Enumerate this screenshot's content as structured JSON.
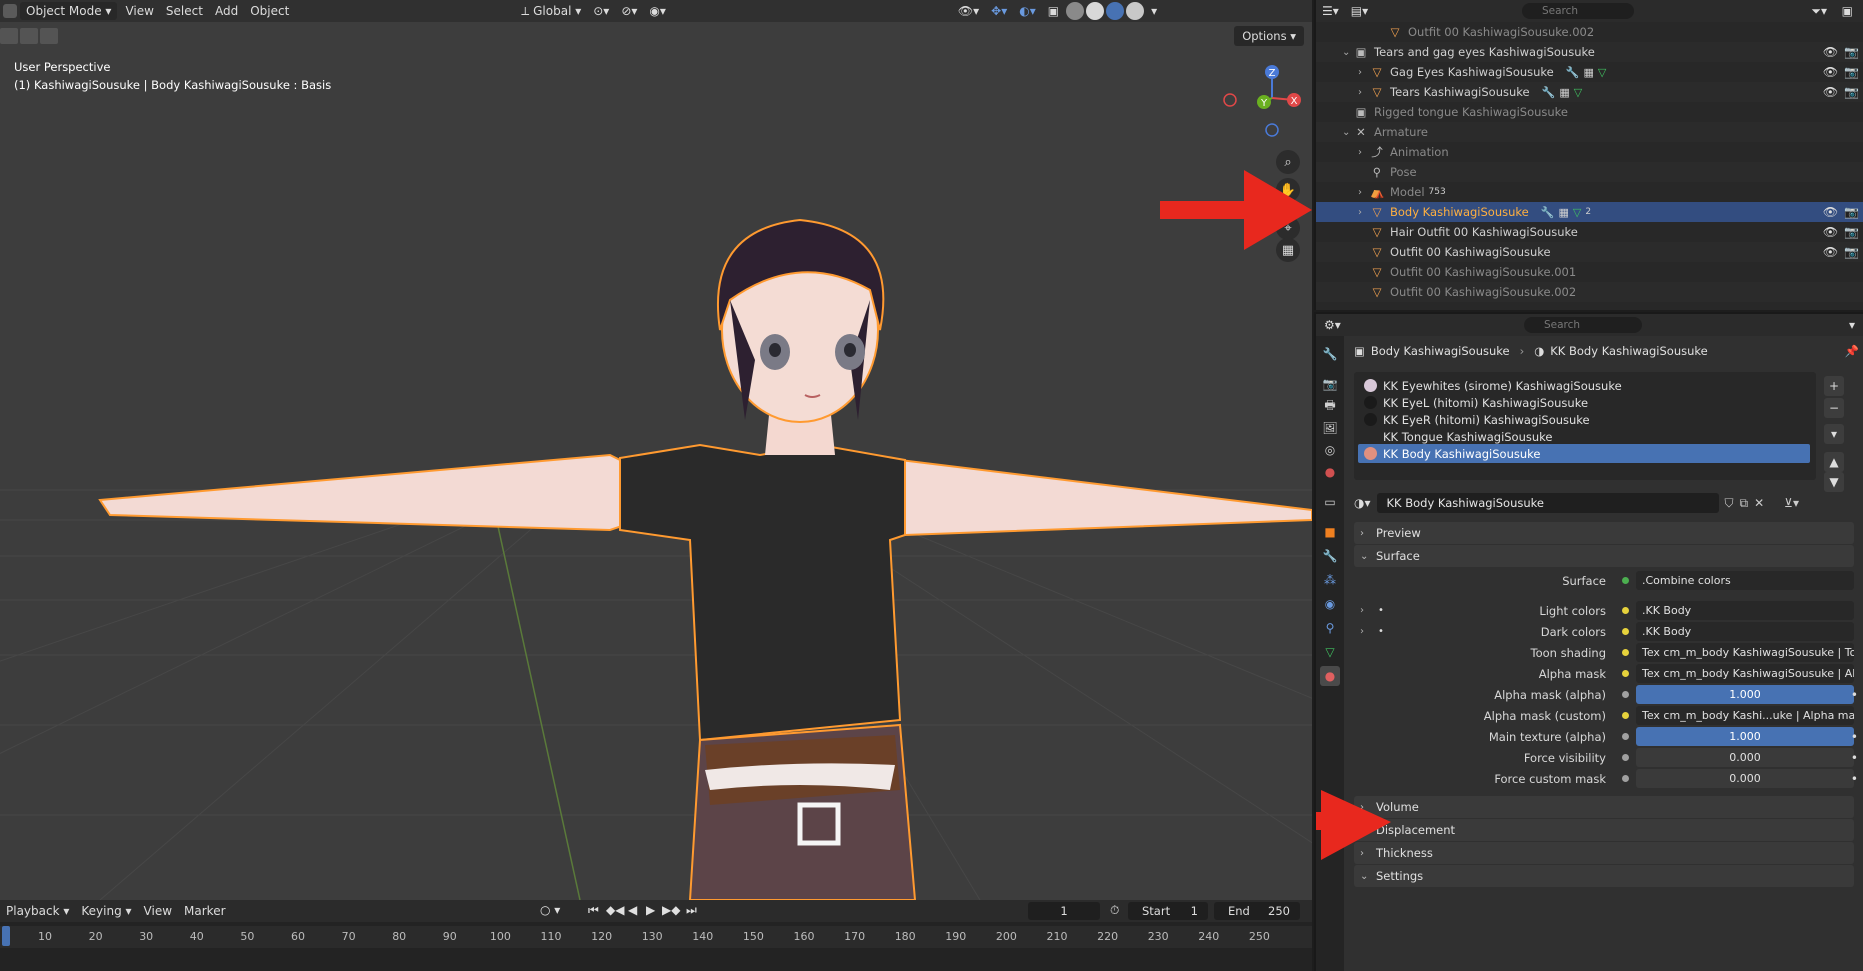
{
  "viewport": {
    "header": {
      "mode": "Object Mode",
      "menus": [
        "View",
        "Select",
        "Add",
        "Object"
      ],
      "orientation": "Global"
    },
    "info_line1": "User Perspective",
    "info_line2": "(1) KashiwagiSousuke | Body KashiwagiSousuke : Basis",
    "options_label": "Options",
    "gizmo": {
      "x": "X",
      "y": "Y",
      "z": "Z"
    }
  },
  "timeline": {
    "menus": [
      "Playback",
      "Keying",
      "View",
      "Marker"
    ],
    "current_frame": "1",
    "start_label": "Start",
    "start_value": "1",
    "end_label": "End",
    "end_value": "250",
    "ticks": [
      "10",
      "20",
      "30",
      "40",
      "50",
      "60",
      "70",
      "80",
      "90",
      "100",
      "110",
      "120",
      "130",
      "140",
      "150",
      "160",
      "170",
      "180",
      "190",
      "200",
      "210",
      "220",
      "230",
      "240",
      "250"
    ]
  },
  "outliner": {
    "search_placeholder": "Search",
    "rows": [
      {
        "label": "Outfit 00 KashiwagiSousuke.002",
        "dim": true
      },
      {
        "label": "Tears and gag eyes KashiwagiSousuke",
        "dim": false
      },
      {
        "label": "Gag Eyes KashiwagiSousuke",
        "dim": false
      },
      {
        "label": "Tears KashiwagiSousuke",
        "dim": false
      },
      {
        "label": "Rigged tongue KashiwagiSousuke",
        "dim": true
      },
      {
        "label": "Armature",
        "dim": true
      },
      {
        "label": "Animation",
        "dim": true
      },
      {
        "label": "Pose",
        "dim": true
      },
      {
        "label": "Model",
        "dim": true,
        "badge": "753"
      },
      {
        "label": "Body KashiwagiSousuke",
        "selected": true,
        "badge": "2"
      },
      {
        "label": "Hair Outfit 00 KashiwagiSousuke",
        "dim": false
      },
      {
        "label": "Outfit 00 KashiwagiSousuke",
        "dim": false
      },
      {
        "label": "Outfit 00 KashiwagiSousuke.001",
        "dim": true
      },
      {
        "label": "Outfit 00 KashiwagiSousuke.002",
        "dim": true
      }
    ]
  },
  "properties": {
    "search_placeholder": "Search",
    "breadcrumb_object": "Body KashiwagiSousuke",
    "breadcrumb_material": "KK Body KashiwagiSousuke",
    "slots": [
      {
        "label": "KK Eyewhites (sirome) KashiwagiSousuke",
        "color": "#d8c8d8"
      },
      {
        "label": "KK EyeL (hitomi) KashiwagiSousuke",
        "color": "#1a1a1a"
      },
      {
        "label": "KK EyeR (hitomi) KashiwagiSousuke",
        "color": "#1a1a1a"
      },
      {
        "label": "KK Tongue KashiwagiSousuke",
        "color": ""
      },
      {
        "label": "KK Body KashiwagiSousuke",
        "color": "#e09080",
        "selected": true
      }
    ],
    "material_name": "KK Body KashiwagiSousuke",
    "panels": {
      "preview": "Preview",
      "surface": "Surface",
      "volume": "Volume",
      "displacement": "Displacement",
      "thickness": "Thickness",
      "settings": "Settings"
    },
    "surface_rows": [
      {
        "label": "Surface",
        "value": ".Combine colors",
        "dot": "#4caf50"
      },
      {
        "label": "Light colors",
        "value": ".KK Body",
        "dot": "#e6d23c"
      },
      {
        "label": "Dark colors",
        "value": ".KK Body",
        "dot": "#e6d23c"
      },
      {
        "label": "Toon shading",
        "value": "Tex cm_m_body KashiwagiSousuke | Toon sh...",
        "dot": "#e6d23c"
      },
      {
        "label": "Alpha mask",
        "value": "Tex cm_m_body KashiwagiSousuke | Alpha m...",
        "dot": "#e6d23c"
      },
      {
        "label": "Alpha mask (alpha)",
        "value": "1.000",
        "dot": "#a0a0a0"
      },
      {
        "label": "Alpha mask (custom)",
        "value": "Tex cm_m_body Kashi...uke | Alpha mask (SFW)",
        "dot": "#e6d23c"
      },
      {
        "label": "Main texture (alpha)",
        "value": "1.000",
        "dot": "#a0a0a0"
      },
      {
        "label": "Force visibility",
        "value": "0.000",
        "dot": "#a0a0a0"
      },
      {
        "label": "Force custom mask",
        "value": "0.000",
        "dot": "#a0a0a0"
      }
    ]
  },
  "colors": {
    "accent_blue": "#4772b3",
    "selection_orange": "#ffb040",
    "annotation_red": "#e8281e"
  }
}
